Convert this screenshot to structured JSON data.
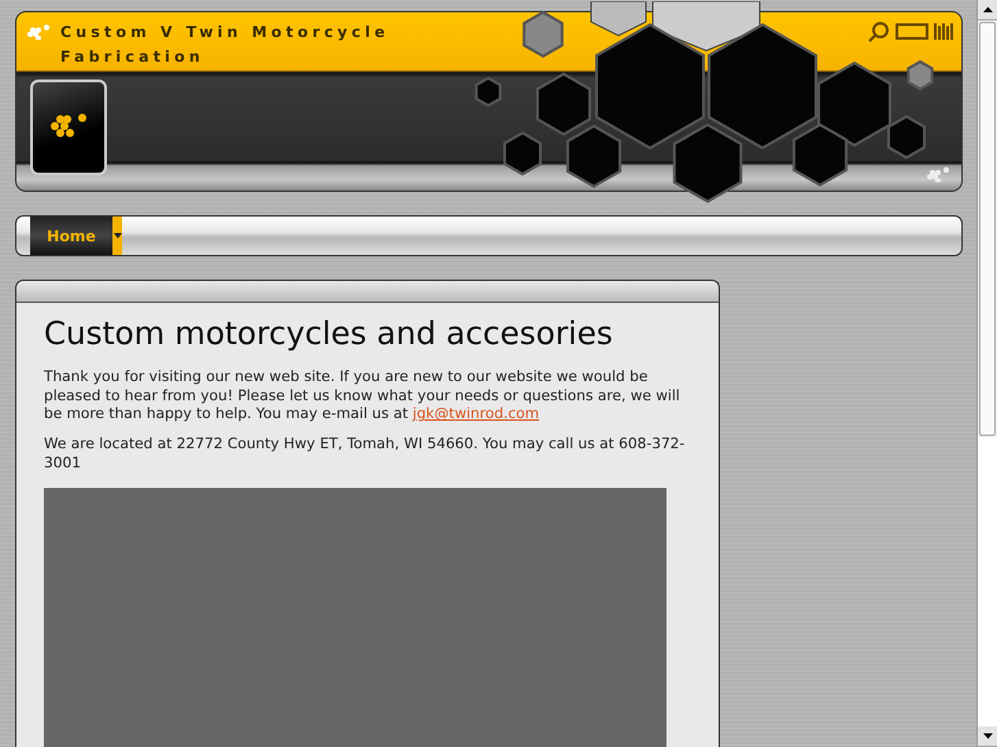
{
  "header": {
    "title": "Custom V Twin Motorcycle Fabrication"
  },
  "nav": {
    "items": [
      {
        "label": "Home",
        "selected": true
      }
    ]
  },
  "content": {
    "heading": "Custom motorcycles and accesories",
    "paragraphs": [
      {
        "text": "Thank you for visiting our new web site. If you are new to our website we would be pleased to hear from you! Please let us know what your needs or questions are, we will be more than happy to help. You may e-mail us at ",
        "link": "jgk@twinrod.com"
      },
      {
        "text": "We are located at 22772 County Hwy ET, Tomah, WI 54660. You may call us at 608-372-3001"
      }
    ]
  }
}
